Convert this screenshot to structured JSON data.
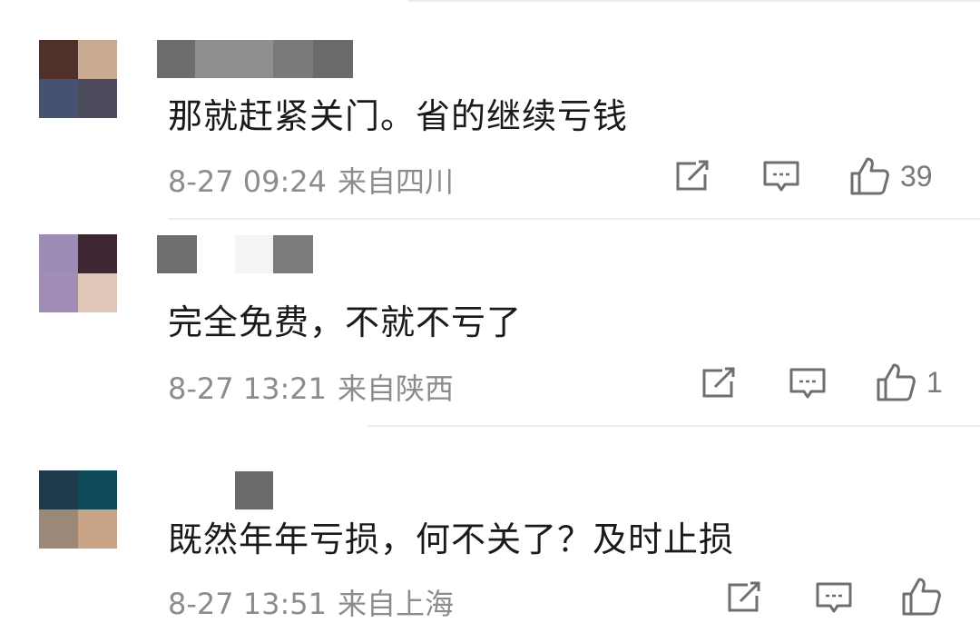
{
  "comments": [
    {
      "avatar_colors": [
        "#4f302a",
        "#c9aa92",
        "#465272",
        "#4d4c5c"
      ],
      "name_blocks": [
        "#6d6d6d",
        "#8f8f8f",
        "#7a7a7a",
        "#6a6a6a"
      ],
      "text": "那就赶紧关门。省的继续亏钱",
      "date": "8-27 09:24",
      "location": "来自四川",
      "likes": "39"
    },
    {
      "avatar_colors": [
        "#9d8cb8",
        "#3f2633",
        "#a18db6",
        "#e0c6b6"
      ],
      "name_blocks": [
        "#6f6f6f",
        "#ffffff",
        "#f4f4f4",
        "#7b7b7b"
      ],
      "text": "完全免费，不就不亏了",
      "date": "8-27 13:21",
      "location": "来自陕西",
      "likes": "1"
    },
    {
      "avatar_colors": [
        "#1d3b4b",
        "#0e4a58",
        "#9c8878",
        "#c9a385"
      ],
      "name_blocks": [
        "#6a6a6a"
      ],
      "text": "既然年年亏损，何不关了？及时止损",
      "date": "8-27 13:51",
      "location": "来自上海",
      "likes": ""
    }
  ],
  "icons": {
    "share": "share-icon",
    "reply": "comment-icon",
    "like": "thumbs-up-icon"
  },
  "colors": {
    "text": "#1a1a1a",
    "meta": "#8c8c8c",
    "icon": "#6f6f6f"
  }
}
